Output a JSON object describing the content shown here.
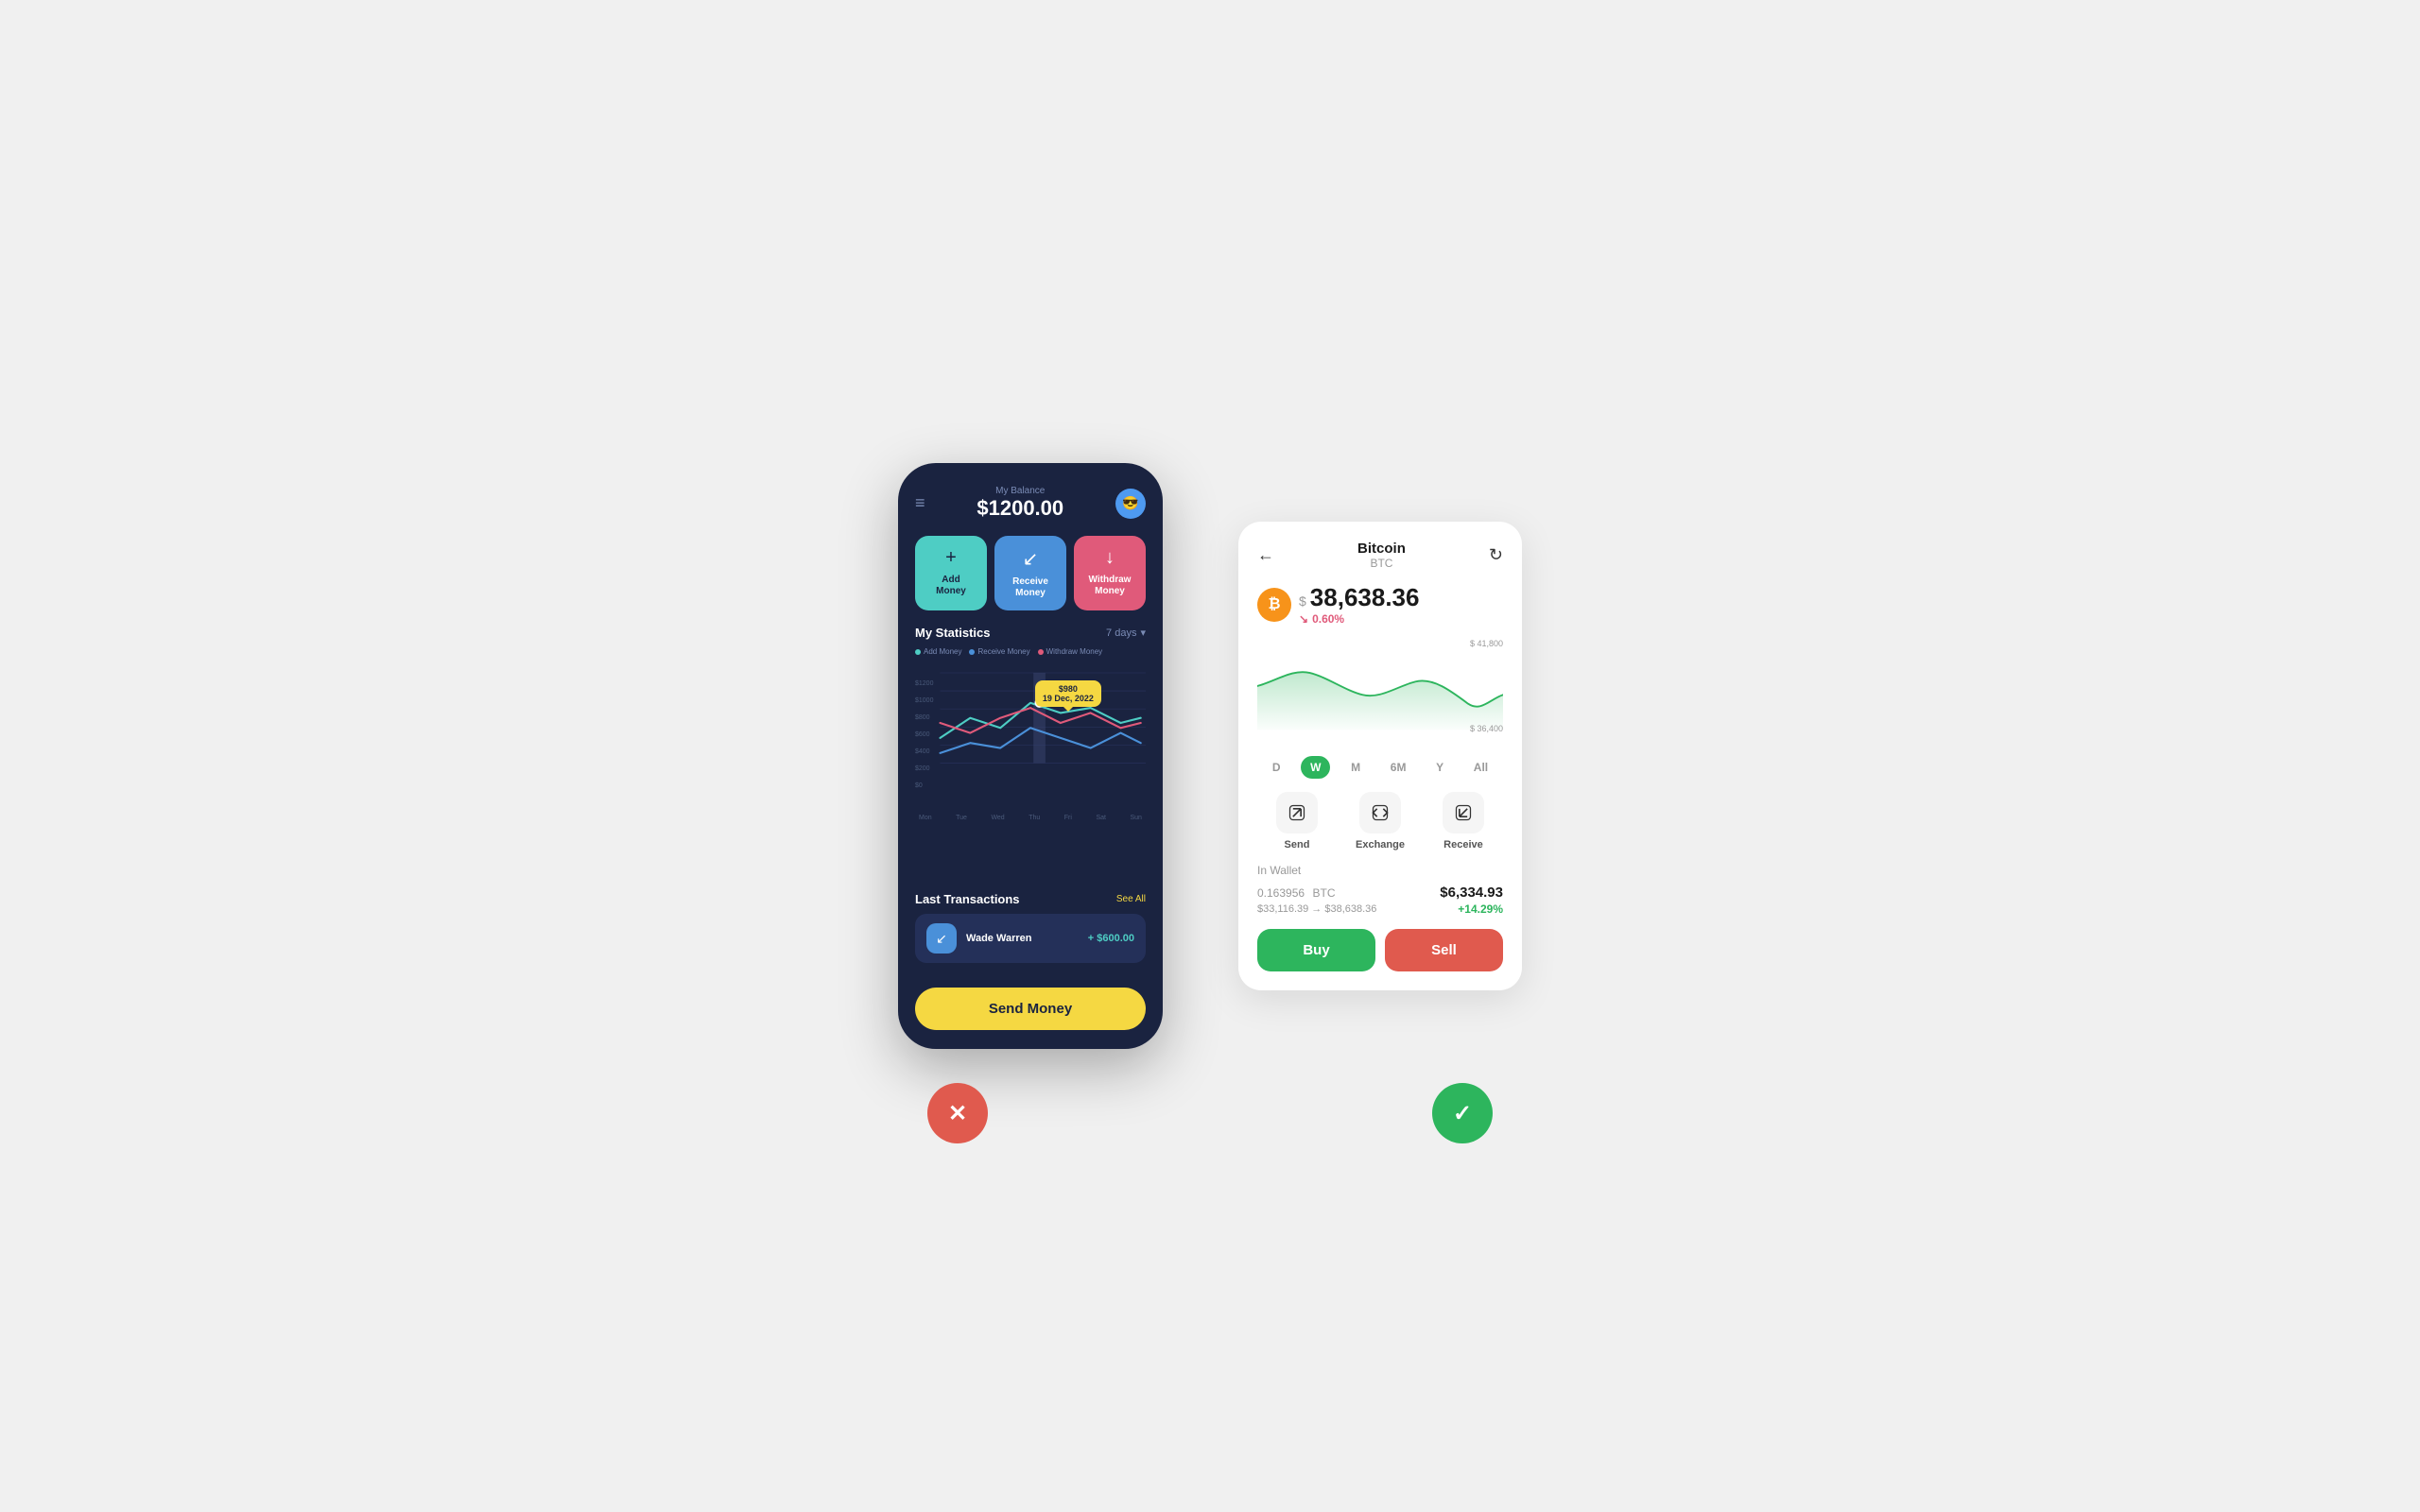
{
  "left_phone": {
    "balance_label": "My Balance",
    "balance_amount": "$1200.00",
    "avatar_emoji": "😎",
    "actions": [
      {
        "label": "Add Money",
        "icon": "+",
        "style": "add"
      },
      {
        "label": "Receive Money",
        "icon": "↙",
        "style": "receive"
      },
      {
        "label": "Withdraw Money",
        "icon": "↓",
        "style": "withdraw"
      }
    ],
    "statistics": {
      "title": "My Statistics",
      "period": "7 days",
      "legend": [
        {
          "label": "Add Money",
          "color": "green"
        },
        {
          "label": "Receive Money",
          "color": "blue"
        },
        {
          "label": "Withdraw Money",
          "color": "red"
        }
      ],
      "tooltip_amount": "$980",
      "tooltip_date": "19 Dec, 2022",
      "y_labels": [
        "$1200",
        "$1000",
        "$800",
        "$600",
        "$400",
        "$200",
        "$0"
      ],
      "x_labels": [
        "Mon",
        "Tue",
        "Wed",
        "Thu",
        "Fri",
        "Sat",
        "Sun"
      ]
    },
    "transactions": {
      "title": "Last Transactions",
      "see_all": "See All",
      "items": [
        {
          "name": "Wade Warren",
          "amount": "+ $600.00",
          "icon": "↙"
        }
      ]
    },
    "send_money_btn": "Send Money"
  },
  "right_card": {
    "back_icon": "←",
    "refresh_icon": "↻",
    "crypto_name": "Bitcoin",
    "crypto_symbol": "BTC",
    "btc_symbol": "₿",
    "dollar_sign": "$",
    "price": "38,638.36",
    "price_change_icon": "↘",
    "price_change": "0.60%",
    "chart_high": "$ 41,800",
    "chart_low": "$ 36,400",
    "time_tabs": [
      {
        "label": "D",
        "active": false
      },
      {
        "label": "W",
        "active": true
      },
      {
        "label": "M",
        "active": false
      },
      {
        "label": "6M",
        "active": false
      },
      {
        "label": "Y",
        "active": false
      },
      {
        "label": "All",
        "active": false
      }
    ],
    "actions": [
      {
        "label": "Send",
        "icon": "↗"
      },
      {
        "label": "Exchange",
        "icon": "⇄"
      },
      {
        "label": "Receive",
        "icon": "↙"
      }
    ],
    "in_wallet_label": "In Wallet",
    "wallet_btc": "0.163956",
    "wallet_btc_unit": "BTC",
    "wallet_usd": "$6,334.93",
    "wallet_range": "$33,116.39 → $38,638.36",
    "wallet_change": "+14.29%",
    "buy_label": "Buy",
    "sell_label": "Sell"
  },
  "bottom": {
    "cancel_icon": "✕",
    "confirm_icon": "✓"
  }
}
